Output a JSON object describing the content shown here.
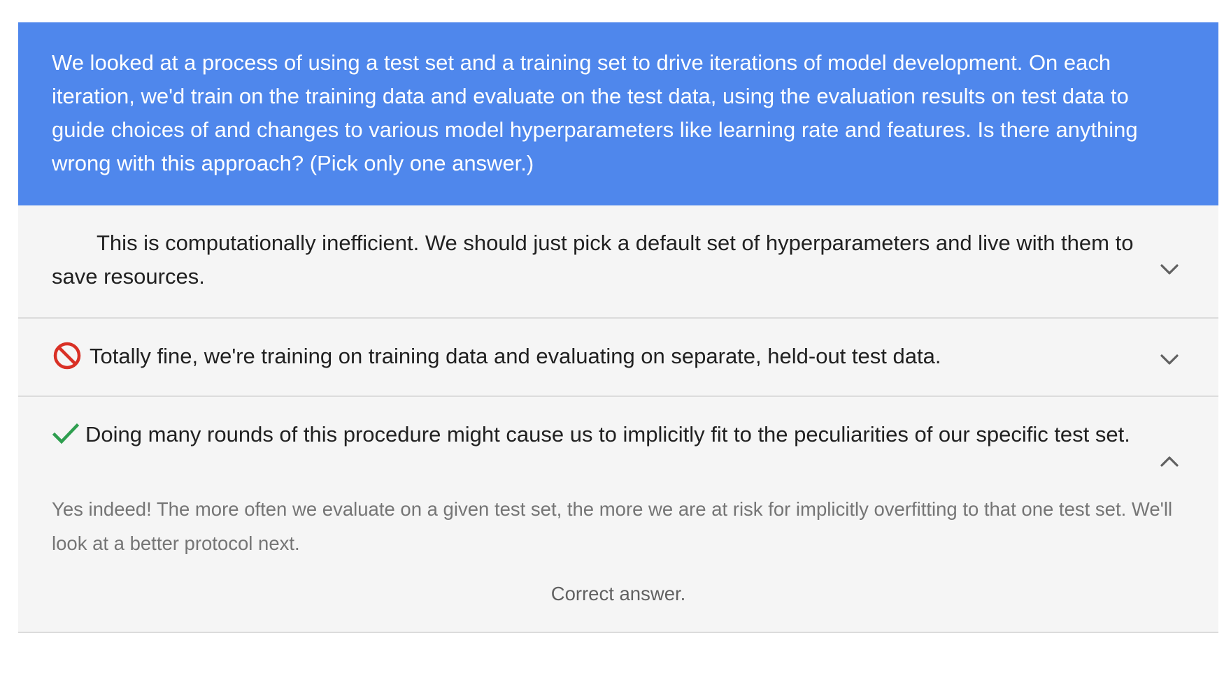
{
  "question": {
    "text": "We looked at a process of using a test set and a training set to drive iterations of model development. On each iteration, we'd train on the training data and evaluate on the test data, using the evaluation results on test data to guide choices of and changes to various model hyperparameters like learning rate and features. Is there anything wrong with this approach? (Pick only one answer.)"
  },
  "options": [
    {
      "text": "This is computationally inefficient. We should just pick a default set of hyperparameters and live with them to save resources.",
      "status": "none",
      "expanded": false,
      "chevron_icon": "chevron-down-icon"
    },
    {
      "text": "Totally fine, we're training on training data and evaluating on separate, held-out test data.",
      "status": "incorrect",
      "status_icon": "prohibited-icon",
      "status_color": "#d93025",
      "expanded": false,
      "chevron_icon": "chevron-down-icon"
    },
    {
      "text": "Doing many rounds of this procedure might cause us to implicitly fit to the peculiarities of our specific test set.",
      "status": "correct",
      "status_icon": "checkmark-icon",
      "status_color": "#2e9e4f",
      "expanded": true,
      "chevron_icon": "chevron-up-icon",
      "explanation": "Yes indeed! The more often we evaluate on a given test set, the more we are at risk for implicitly overfitting to that one test set. We'll look at a better protocol next.",
      "verdict": "Correct answer."
    }
  ],
  "colors": {
    "question_bg": "#4f87ec",
    "option_bg": "#f5f5f5",
    "divider": "#dcdcdc"
  }
}
